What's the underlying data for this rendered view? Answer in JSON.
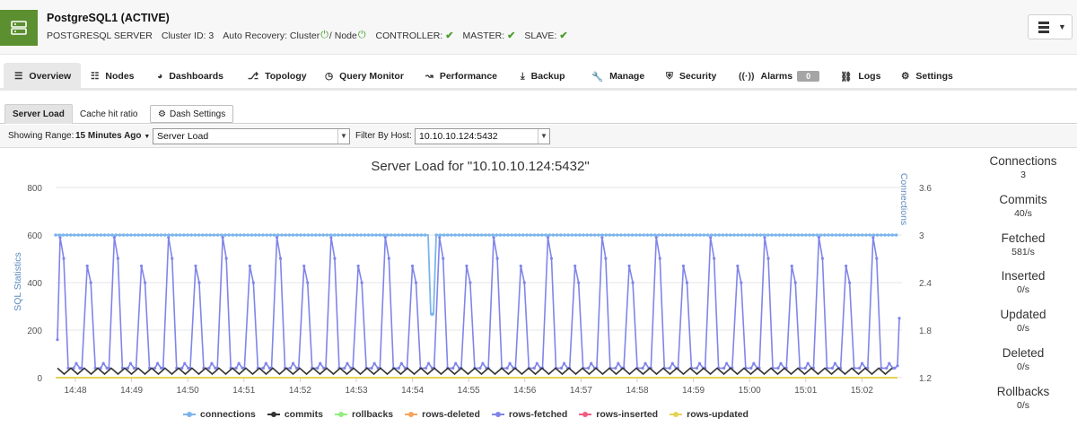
{
  "header": {
    "title": "PostgreSQL1 (ACTIVE)",
    "server_type": "POSTGRESQL SERVER",
    "cluster_id": "Cluster ID: 3",
    "auto_recovery_label": "Auto Recovery: Cluster",
    "auto_recovery_node": "/ Node",
    "controller": "CONTROLLER:",
    "master": "MASTER:",
    "slave": "SLAVE:"
  },
  "tabs": [
    {
      "label": "Overview",
      "icon": "list-icon"
    },
    {
      "label": "Nodes",
      "icon": "nodes-icon"
    },
    {
      "label": "Dashboards",
      "icon": "dashboard-icon"
    },
    {
      "label": "Topology",
      "icon": "topology-icon"
    },
    {
      "label": "Query Monitor",
      "icon": "clock-icon"
    },
    {
      "label": "Performance",
      "icon": "line-chart-icon"
    },
    {
      "label": "Backup",
      "icon": "download-icon"
    },
    {
      "label": "Manage",
      "icon": "wrench-icon"
    },
    {
      "label": "Security",
      "icon": "shield-icon"
    },
    {
      "label": "Alarms",
      "icon": "wifi-icon",
      "badge": "0"
    },
    {
      "label": "Logs",
      "icon": "drive-icon"
    },
    {
      "label": "Settings",
      "icon": "gear-icon"
    }
  ],
  "subtabs": {
    "server_load": "Server Load",
    "cache_hit": "Cache hit ratio",
    "dash_settings": "Dash Settings"
  },
  "filter": {
    "showing_range_label": "Showing Range:",
    "range_value": "15 Minutes Ago",
    "metric_select": "Server Load",
    "filter_host_label": "Filter By Host:",
    "host_select": "10.10.10.124:5432"
  },
  "chart_data": {
    "type": "line",
    "title": "Server Load for \"10.10.10.124:5432\"",
    "ylabel_left": "SQL Statistics",
    "ylabel_right": "Connections",
    "y_left_ticks": [
      "800",
      "600",
      "400",
      "200",
      "0"
    ],
    "y_right_ticks": [
      "3.6",
      "3",
      "2.4",
      "1.8",
      "1.2"
    ],
    "ylim_left": [
      0,
      800
    ],
    "ylim_right": [
      1.2,
      3.6
    ],
    "x_ticks": [
      "14:48",
      "14:49",
      "14:50",
      "14:51",
      "14:52",
      "14:53",
      "14:54",
      "14:55",
      "14:56",
      "14:57",
      "14:58",
      "14:59",
      "15:00",
      "15:01",
      "15:02"
    ],
    "legend_position": "bottom",
    "grid": true,
    "series": [
      {
        "name": "connections",
        "axis": "right",
        "color": "#7cb5ec",
        "value": 3,
        "dip": {
          "x": "14:54",
          "value": 2.0
        }
      },
      {
        "name": "commits",
        "axis": "left",
        "color": "#333333",
        "range": [
          15,
          40
        ]
      },
      {
        "name": "rollbacks",
        "axis": "left",
        "color": "#90ed7d",
        "value": 0
      },
      {
        "name": "rows-deleted",
        "axis": "left",
        "color": "#f7a35c",
        "value": 0
      },
      {
        "name": "rows-fetched",
        "axis": "left",
        "color": "#8085e9",
        "baseline": 40,
        "peaks": [
          590,
          470,
          590,
          470,
          590,
          470,
          590,
          470,
          590,
          470,
          590,
          470,
          590,
          470,
          590,
          470,
          590,
          470,
          590,
          470,
          590,
          470,
          590,
          470,
          590,
          470,
          590,
          470,
          590,
          470,
          590
        ]
      },
      {
        "name": "rows-inserted",
        "axis": "left",
        "color": "#f15c80",
        "value": 0
      },
      {
        "name": "rows-updated",
        "axis": "left",
        "color": "#e4d354",
        "value": 0
      }
    ]
  },
  "stats": [
    {
      "label": "Connections",
      "value": "3"
    },
    {
      "label": "Commits",
      "value": "40/s"
    },
    {
      "label": "Fetched",
      "value": "581/s"
    },
    {
      "label": "Inserted",
      "value": "0/s"
    },
    {
      "label": "Updated",
      "value": "0/s"
    },
    {
      "label": "Deleted",
      "value": "0/s"
    },
    {
      "label": "Rollbacks",
      "value": "0/s"
    }
  ]
}
